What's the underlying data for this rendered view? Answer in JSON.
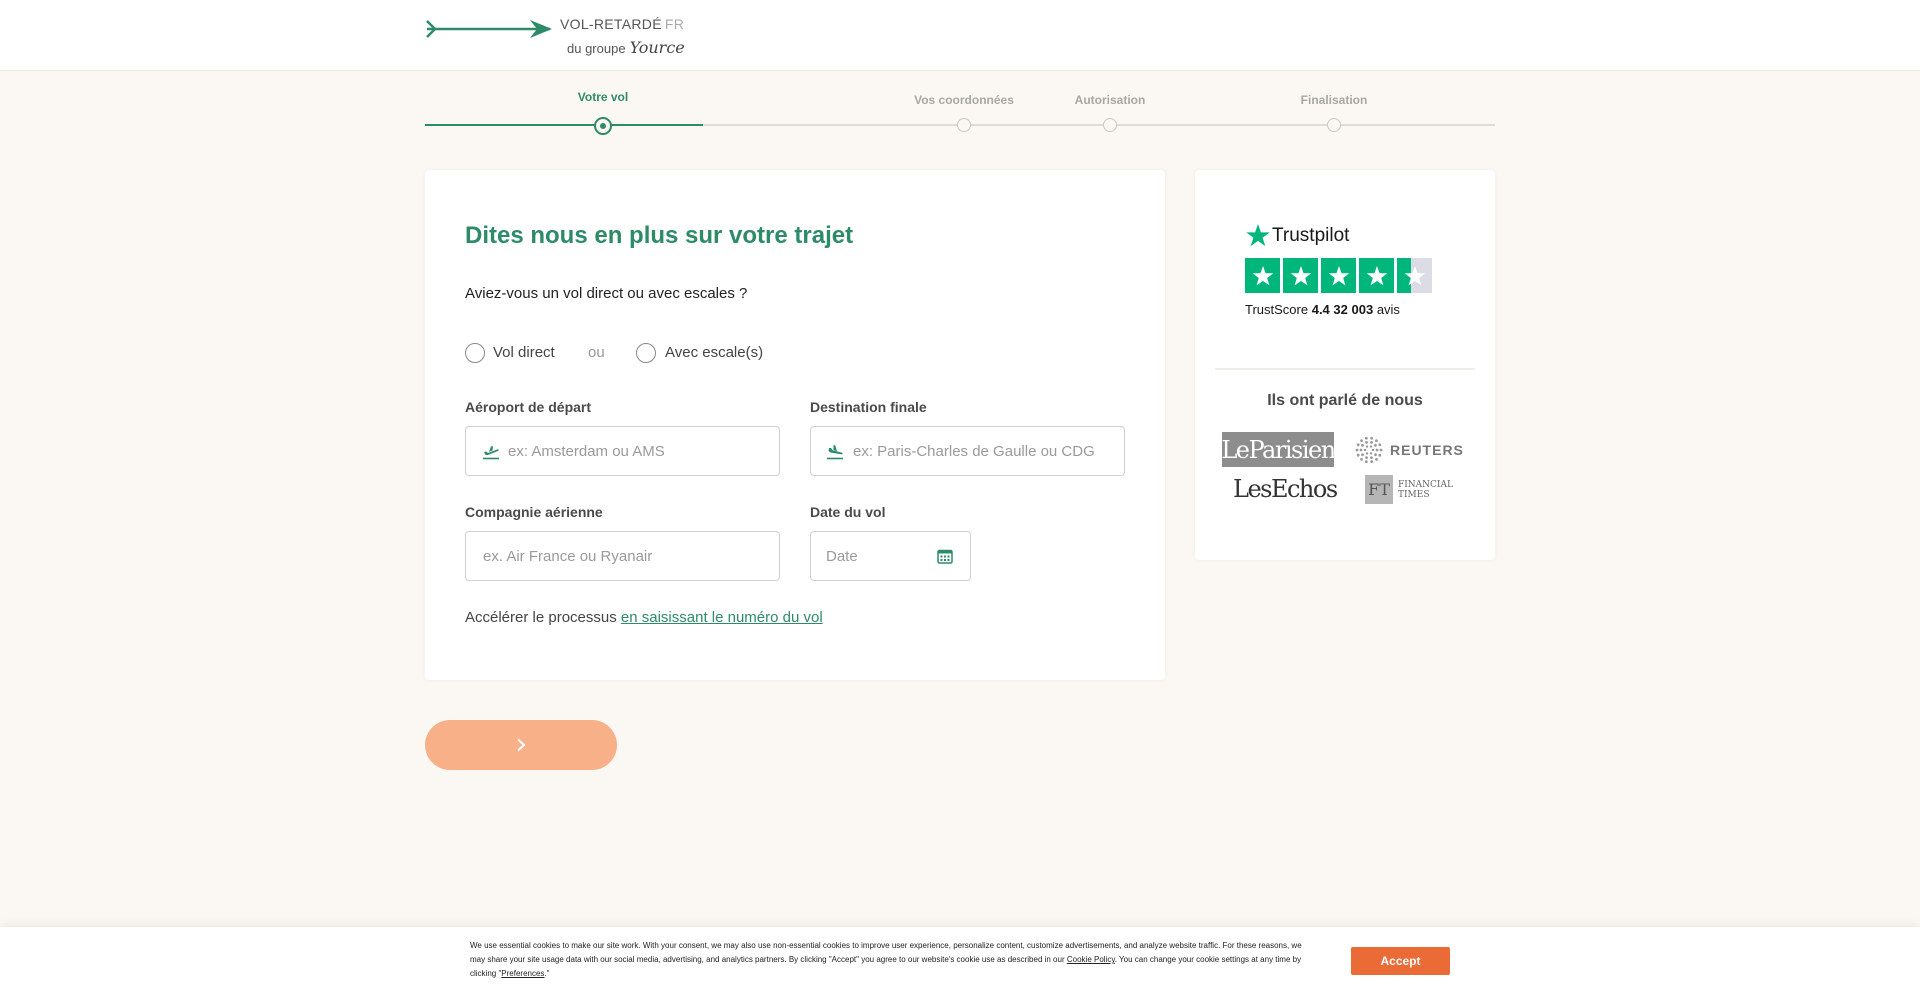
{
  "header": {
    "logo_title": "VOL-RETARDÉ",
    "logo_suffix": "FR",
    "logo_sub": "du groupe",
    "logo_brand": "Yource"
  },
  "stepper": {
    "steps": [
      {
        "label": "Votre vol",
        "state": "active"
      },
      {
        "label": "Vos coordonnées",
        "state": "pending"
      },
      {
        "label": "Autorisation",
        "state": "pending"
      },
      {
        "label": "Finalisation",
        "state": "pending"
      }
    ]
  },
  "form": {
    "title": "Dites nous en plus sur votre trajet",
    "question": "Aviez-vous un vol direct ou avec escales ?",
    "option_direct": "Vol direct",
    "option_or": "ou",
    "option_stopover": "Avec escale(s)",
    "departure_label": "Aéroport de départ",
    "departure_placeholder": "ex: Amsterdam ou AMS",
    "departure_value": "",
    "destination_label": "Destination finale",
    "destination_placeholder": "ex: Paris-Charles de Gaulle ou CDG",
    "destination_value": "",
    "airline_label": "Compagnie aérienne",
    "airline_placeholder": "ex. Air France ou Ryanair",
    "airline_value": "",
    "date_label": "Date du vol",
    "date_placeholder": "Date",
    "date_value": "",
    "speed_text": "Accélérer le processus",
    "speed_link": "en saisissant le numéro du vol"
  },
  "next_button": {
    "icon": "chevron-right-icon"
  },
  "trustpilot": {
    "name": "Trustpilot",
    "rating": 4.4,
    "score_label": "TrustScore",
    "score_value": "4.4",
    "reviews": "32 003",
    "reviews_label": "avis",
    "color": "#00b67a"
  },
  "press": {
    "title": "Ils ont parlé de nous",
    "logos": [
      "LeParisien",
      "REUTERS",
      "LesEchos",
      "FINANCIAL TIMES"
    ],
    "parisien": "LeParisien",
    "reuters": "REUTERS",
    "echos": "LesEchos",
    "ft_mark": "FT",
    "ft_line1": "FINANCIAL",
    "ft_line2": "TIMES"
  },
  "cookie": {
    "text_before": "We use essential cookies to make our site work. With your consent, we may also use non-essential cookies to improve user experience, personalize content, customize advertisements, and analyze website traffic. For these reasons, we may share your site usage data with our social media, advertising, and analytics partners. By clicking \"Accept\" you agree to our website's cookie use as described in our",
    "policy_link": "Cookie Policy",
    "text_middle": ". You can change your cookie settings at any time by clicking \"",
    "preferences_link": "Preferences",
    "text_after": ".\"",
    "accept_label": "Accept"
  },
  "colors": {
    "brand_green": "#2e8b68",
    "next_button": "#f8b088",
    "accept_button": "#ea6b35",
    "background": "#fbf8f3"
  }
}
